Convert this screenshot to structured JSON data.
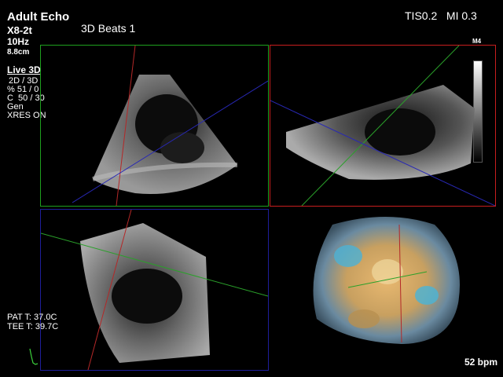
{
  "header": {
    "app_title": "Adult Echo",
    "probe": "X8-2t",
    "frame_rate": "10Hz",
    "depth": "8.8cm",
    "mode_title": "3D Beats 1",
    "tis_mi": "TIS0.2   MI 0.3",
    "map_label": "M4"
  },
  "settings": {
    "live3d": "Live 3D",
    "lines": [
      "2D / 3D",
      "% 51 / 0",
      "C  50 / 30",
      "Gen",
      "XRES ON"
    ]
  },
  "temps": {
    "pat": "PAT T: 37.0C",
    "tee": "TEE T: 39.7C"
  },
  "heart_rate": "52 bpm",
  "colors": {
    "pane_a_border": "#1ea01e",
    "pane_b_border": "#c81e1e",
    "pane_c_border": "#1e1e9a",
    "ecg_trace": "#3cd23c"
  },
  "panes": [
    "pane-a",
    "pane-b",
    "pane-c",
    "pane-d"
  ]
}
